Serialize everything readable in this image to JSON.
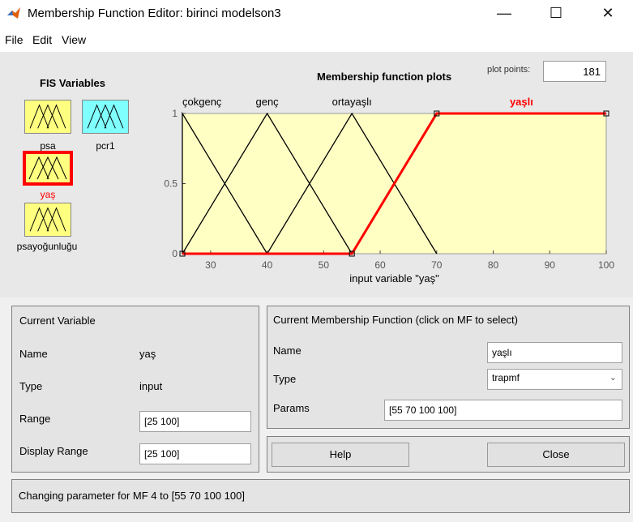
{
  "window": {
    "title": "Membership Function Editor: birinci modelson3",
    "controls": {
      "minimize": "—",
      "maximize": "☐",
      "close": "✕"
    }
  },
  "menu": {
    "items": [
      "File",
      "Edit",
      "View"
    ]
  },
  "fis_variables": {
    "title": "FIS Variables",
    "items": [
      {
        "label": "psa",
        "color": "#ffff80",
        "selected": false
      },
      {
        "label": "pcr1",
        "color": "#80ffff",
        "selected": false
      },
      {
        "label": "yaş",
        "color": "#ffff80",
        "selected": true
      },
      {
        "label": "psayoğunluğu",
        "color": "#ffff80",
        "selected": false
      }
    ]
  },
  "plot": {
    "title": "Membership function plots",
    "plot_points_label": "plot points:",
    "plot_points_value": "181",
    "xlabel": "input variable \"yaş\"",
    "selected_mf_color": "#ff0000"
  },
  "chart_data": {
    "type": "line",
    "xlabel": "input variable \"yaş\"",
    "xlim": [
      25,
      100
    ],
    "ylim": [
      0,
      1
    ],
    "x_ticks": [
      "30",
      "40",
      "50",
      "60",
      "70",
      "80",
      "90",
      "100"
    ],
    "y_ticks": [
      "0",
      "0.5",
      "1"
    ],
    "series": [
      {
        "name": "çokgenç",
        "x": [
          25,
          25,
          40
        ],
        "y": [
          0,
          1,
          0
        ],
        "selected": false
      },
      {
        "name": "genç",
        "x": [
          25,
          40,
          55
        ],
        "y": [
          0,
          1,
          0
        ],
        "selected": false
      },
      {
        "name": "ortayaşlı",
        "x": [
          40,
          55,
          70
        ],
        "y": [
          0,
          1,
          0
        ],
        "selected": false
      },
      {
        "name": "yaşlı",
        "x": [
          25,
          55,
          70,
          100
        ],
        "y": [
          0,
          0,
          1,
          1
        ],
        "selected": true
      }
    ]
  },
  "current_variable": {
    "title": "Current Variable",
    "name_label": "Name",
    "name_value": "yaş",
    "type_label": "Type",
    "type_value": "input",
    "range_label": "Range",
    "range_value": "[25 100]",
    "display_range_label": "Display Range",
    "display_range_value": "[25 100]"
  },
  "current_mf": {
    "title": "Current Membership Function (click on MF to select)",
    "name_label": "Name",
    "name_value": "yaşlı",
    "type_label": "Type",
    "type_value": "trapmf",
    "params_label": "Params",
    "params_value": "[55 70 100 100]"
  },
  "buttons": {
    "help": "Help",
    "close": "Close"
  },
  "status": {
    "message": "Changing parameter for MF 4 to  [55 70 100 100]"
  }
}
